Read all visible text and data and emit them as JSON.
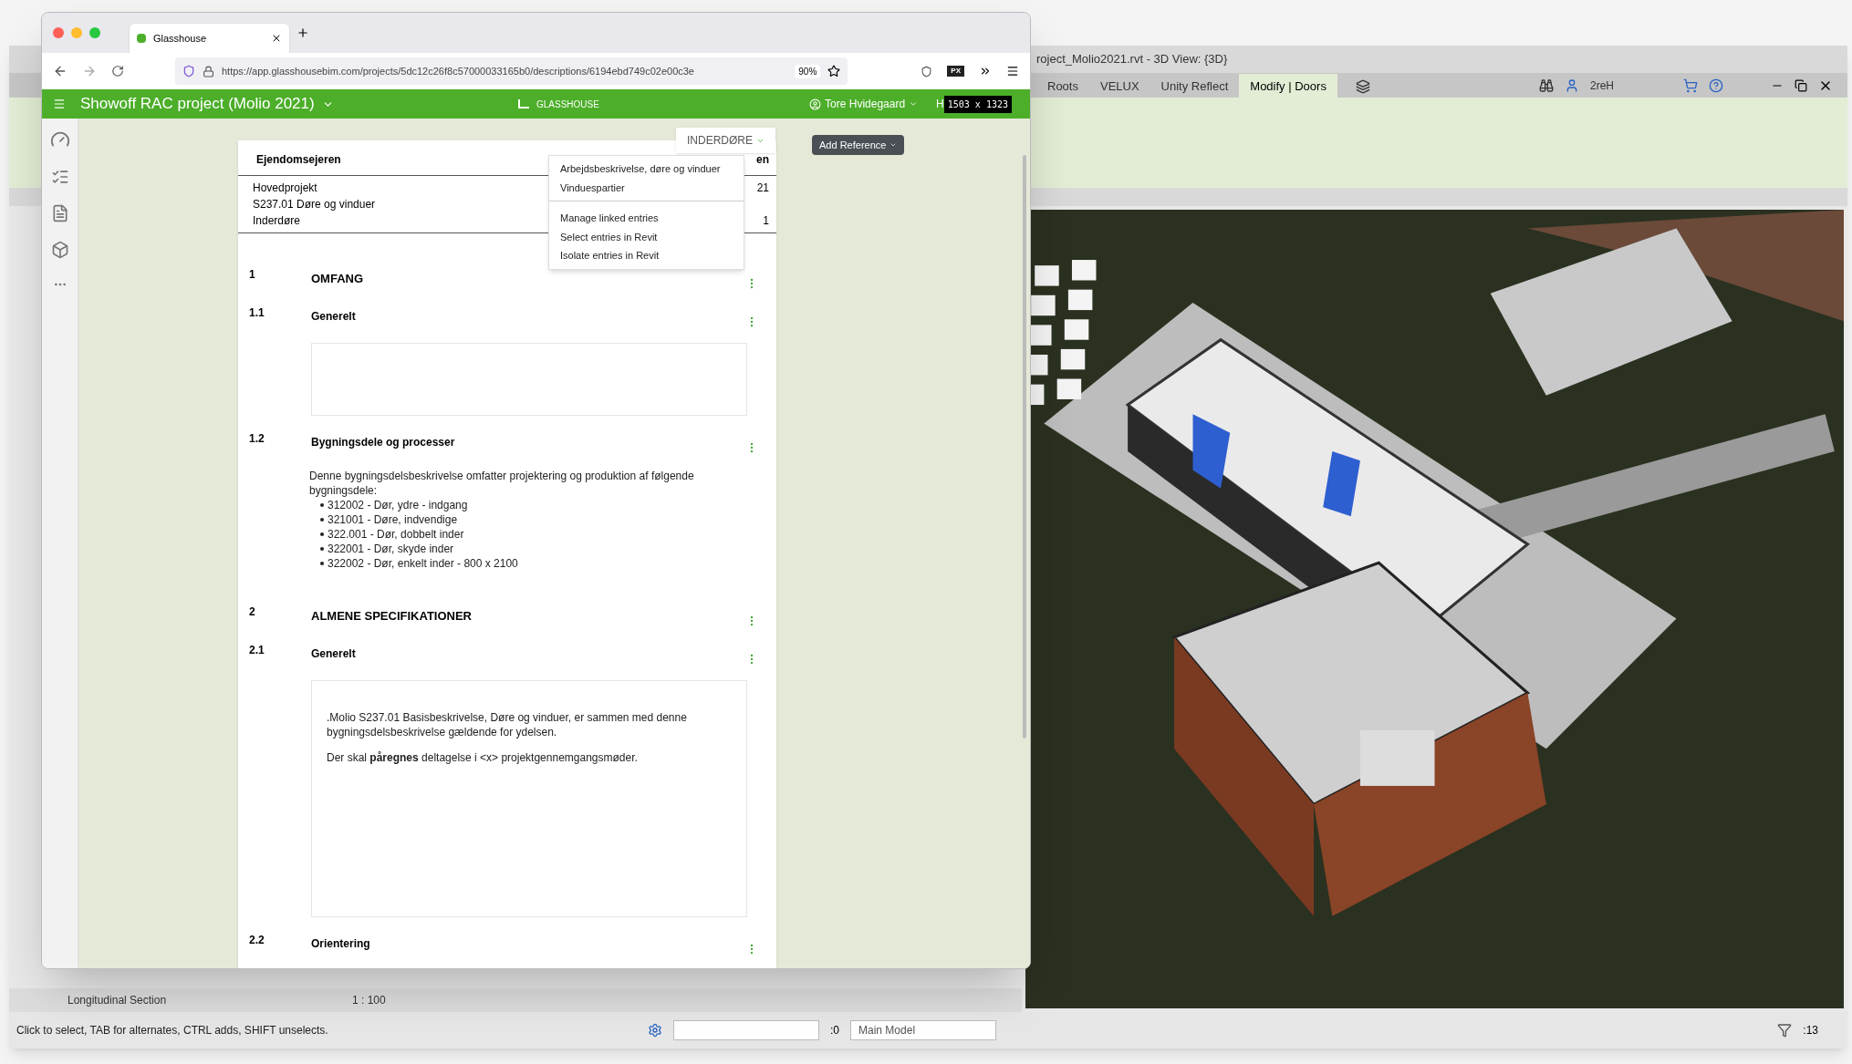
{
  "revit": {
    "title": "roject_Molio2021.rvt - 3D View: {3D}",
    "ribbon_tabs": [
      {
        "label": "Roots",
        "selected": false
      },
      {
        "label": "VELUX",
        "selected": false
      },
      {
        "label": "Unity Reflect",
        "selected": false
      },
      {
        "label": "Modify | Doors",
        "selected": true
      }
    ],
    "user": "2reH",
    "view_bar": {
      "view_name": "Longitudinal Section",
      "scale": "1 : 100"
    },
    "status": {
      "hint": "Click to select, TAB for alternates, CTRL adds, SHIFT unselects.",
      "editable_count": ":0",
      "model": "Main Model",
      "filter_count": ":13"
    }
  },
  "browser": {
    "tab": {
      "title": "Glasshouse"
    },
    "url": "https://app.glasshousebim.com/projects/5dc12c26f8c57000033165b0/descriptions/6194ebd749c02e00c3e",
    "zoom": "90%",
    "extension_label": "PX"
  },
  "app": {
    "project": "Showoff RAC project (Molio 2021)",
    "logo": "**GLASS**HOUSE",
    "user": "Tore Hvidegaard",
    "header_cut": "H",
    "size_overlay": "1503 x 1323",
    "filter_button": "INDERDØRE",
    "add_reference": "Add Reference",
    "menu": [
      {
        "items": [
          "Arbejdsbeskrivelse, døre og vinduer",
          "Vinduespartier"
        ]
      },
      {
        "items": [
          "Manage linked entries",
          "Select entries in Revit",
          "Isolate entries in Revit"
        ]
      }
    ],
    "document": {
      "header_title": "Ejendomsejeren",
      "header_lines": [
        "Hovedprojekt",
        "S237.01 Døre og vinduer",
        "Inderdøre"
      ],
      "column_2": [
        "en",
        "21",
        "1"
      ],
      "sections": [
        {
          "number": "1",
          "title": "OMFANG",
          "kind": "chapter"
        },
        {
          "number": "1.1",
          "title": "Generelt",
          "kind": "section",
          "box": {
            "empty": true
          }
        },
        {
          "number": "1.2",
          "title": "Bygningsdele og processer",
          "kind": "section",
          "intro": "Denne bygningsdelsbeskrivelse omfatter projektering og produktion af følgende bygningsdele:",
          "bullets": [
            "312002 - Dør, ydre - indgang",
            "321001 - Døre, indvendige",
            "322.001 - Dør, dobbelt inder",
            "322001 - Dør, skyde inder",
            "322002 - Dør, enkelt inder - 800 x 2100"
          ]
        },
        {
          "number": "2",
          "title": "ALMENE SPECIFIKATIONER",
          "kind": "chapter"
        },
        {
          "number": "2.1",
          "title": "Generelt",
          "kind": "section",
          "box": {
            "paragraphs": [
              ".Molio S237.01 Basisbeskrivelse, Døre og vinduer, er sammen med denne bygningsdelsbeskrivelse gældende for ydelsen.",
              "Der skal **påregnes** deltagelse i <x> projektgennemgangsmøder."
            ]
          }
        },
        {
          "number": "2.2",
          "title": "Orientering",
          "kind": "section"
        }
      ]
    }
  }
}
